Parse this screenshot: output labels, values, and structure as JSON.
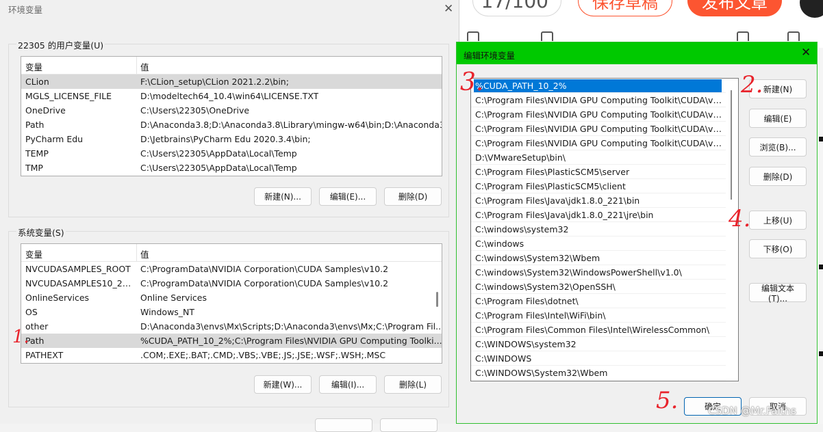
{
  "background_page": {
    "counter": "17/100",
    "save_draft": "保存草稿",
    "publish": "发布文章"
  },
  "env_dialog": {
    "title": "环境变量",
    "user_group_label": "22305 的用户变量(U)",
    "user_columns": [
      "变量",
      "值"
    ],
    "user_rows": [
      {
        "name": "CLion",
        "value": "F:\\CLion_setup\\CLion 2021.2.2\\bin;"
      },
      {
        "name": "MGLS_LICENSE_FILE",
        "value": "D:\\modeltech64_10.4\\win64\\LICENSE.TXT"
      },
      {
        "name": "OneDrive",
        "value": "C:\\Users\\22305\\OneDrive"
      },
      {
        "name": "Path",
        "value": "D:\\Anaconda3.8;D:\\Anaconda3.8\\Library\\mingw-w64\\bin;D:\\Anaconda3.8..."
      },
      {
        "name": "PyCharm Edu",
        "value": "D:\\Jetbrains\\PyCharm Edu 2020.3.4\\bin;"
      },
      {
        "name": "TEMP",
        "value": "C:\\Users\\22305\\AppData\\Local\\Temp"
      },
      {
        "name": "TMP",
        "value": "C:\\Users\\22305\\AppData\\Local\\Temp"
      }
    ],
    "user_buttons": {
      "new": "新建(N)...",
      "edit": "编辑(E)...",
      "delete": "删除(D)"
    },
    "system_group_label": "系统变量(S)",
    "system_columns": [
      "变量",
      "值"
    ],
    "system_rows": [
      {
        "name": "NVCUDASAMPLES_ROOT",
        "value": "C:\\ProgramData\\NVIDIA Corporation\\CUDA Samples\\v10.2"
      },
      {
        "name": "NVCUDASAMPLES10_2_R...",
        "value": "C:\\ProgramData\\NVIDIA Corporation\\CUDA Samples\\v10.2"
      },
      {
        "name": "OnlineServices",
        "value": "Online Services"
      },
      {
        "name": "OS",
        "value": "Windows_NT"
      },
      {
        "name": "other",
        "value": "D:\\Anaconda3\\envs\\Mx\\Scripts;D:\\Anaconda3\\envs\\Mx;C:\\Program Fil..."
      },
      {
        "name": "Path",
        "value": "%CUDA_PATH_10_2%;C:\\Program Files\\NVIDIA GPU Computing Toolki..."
      },
      {
        "name": "PATHEXT",
        "value": ".COM;.EXE;.BAT;.CMD;.VBS;.VBE;.JS;.JSE;.WSF;.WSH;.MSC"
      }
    ],
    "system_selected_index": 5,
    "system_buttons": {
      "new": "新建(W)...",
      "edit": "编辑(I)...",
      "delete": "删除(L)"
    }
  },
  "edit_dialog": {
    "title": "编辑环境变量",
    "paths": [
      "%CUDA_PATH_10_2%",
      "C:\\Program Files\\NVIDIA GPU Computing Toolkit\\CUDA\\v10....",
      "C:\\Program Files\\NVIDIA GPU Computing Toolkit\\CUDA\\v10....",
      "C:\\Program Files\\NVIDIA GPU Computing Toolkit\\CUDA\\v11....",
      "C:\\Program Files\\NVIDIA GPU Computing Toolkit\\CUDA\\v11....",
      "D:\\VMwareSetup\\bin\\",
      "C:\\Program Files\\PlasticSCM5\\server",
      "C:\\Program Files\\PlasticSCM5\\client",
      "C:\\Program Files\\Java\\jdk1.8.0_221\\bin",
      "C:\\Program Files\\Java\\jdk1.8.0_221\\jre\\bin",
      "C:\\windows\\system32",
      "C:\\windows",
      "C:\\windows\\System32\\Wbem",
      "C:\\windows\\System32\\WindowsPowerShell\\v1.0\\",
      "C:\\windows\\System32\\OpenSSH\\",
      "C:\\Program Files\\dotnet\\",
      "C:\\Program Files\\Intel\\WiFi\\bin\\",
      "C:\\Program Files\\Common Files\\Intel\\WirelessCommon\\",
      "C:\\WINDOWS\\system32",
      "C:\\WINDOWS",
      "C:\\WINDOWS\\System32\\Wbem"
    ],
    "selected_index": 0,
    "buttons": {
      "new": "新建(N)",
      "edit": "编辑(E)",
      "browse": "浏览(B)...",
      "delete": "删除(D)",
      "move_up": "上移(U)",
      "move_down": "下移(O)",
      "edit_text": "编辑文本(T)...",
      "ok": "确定",
      "cancel": "取消"
    }
  },
  "annotations": {
    "step1": "1.",
    "step2": "2.",
    "step3": "3.",
    "step4": "4.",
    "step5": "5."
  },
  "watermark": "CSDN @Mr.Faiths",
  "colors": {
    "accent_blue": "#0078d7",
    "title_green": "#00c900",
    "annotation_red": "#e8242c",
    "csdn_orange": "#fc5531"
  }
}
